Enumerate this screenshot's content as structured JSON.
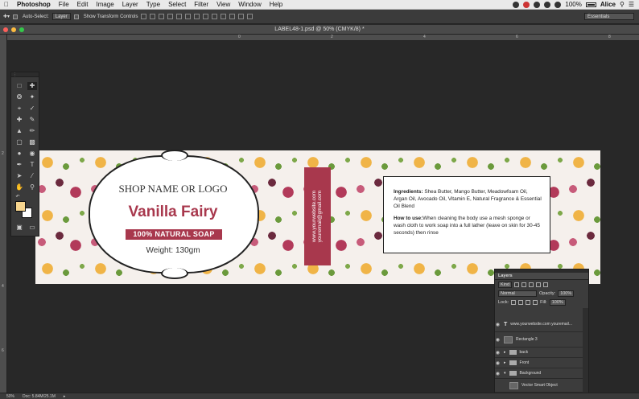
{
  "menubar": {
    "apple": "",
    "app": "Photoshop",
    "items": [
      "File",
      "Edit",
      "Image",
      "Layer",
      "Type",
      "Select",
      "Filter",
      "View",
      "Window",
      "Help"
    ],
    "battery": "100%",
    "user": "Alice"
  },
  "options": {
    "auto_select_label": "Auto-Select:",
    "auto_select_value": "Layer",
    "transform_label": "Show Transform Controls",
    "workspace": "Essentials"
  },
  "document": {
    "title": "LABEL48-1.psd @ 50% (CMYK/8) *",
    "ruler_h": [
      "0",
      "2",
      "4",
      "6",
      "8"
    ],
    "ruler_v": [
      "2",
      "4",
      "6"
    ]
  },
  "label": {
    "shop": "SHOP NAME OR LOGO",
    "product": "Vanilla Fairy",
    "badge": "100% NATURAL SOAP",
    "weight": "Weight: 130gm",
    "strip_line1": "www.yourwebsite.com",
    "strip_line2": "youremail@gmail.com",
    "ingredients_title": "Ingredients:",
    "ingredients": " Shea Butter, Mango Butter, Meadowfoam Oil, Argan Oil, Avocado Oil, Vitamin E, Natural Fragrance & Essential Oil Blend",
    "howto_title": "How to use:",
    "howto": "When cleaning the body use a mesh sponge or wash cloth to work soap into a full lather (leave on skin for 30-45 seconds) then rinse"
  },
  "layers": {
    "tab": "Layers",
    "kind": "Kind",
    "blend": "Normal",
    "opacity_label": "Opacity:",
    "opacity": "100%",
    "lock_label": "Lock:",
    "fill_label": "Fill:",
    "fill": "100%",
    "rows": [
      {
        "name": "www.yourwebsite.com youremail...",
        "type": "text"
      },
      {
        "name": "Rectangle 3",
        "type": "shape"
      },
      {
        "name": "back",
        "type": "folder"
      },
      {
        "name": "Front",
        "type": "folder"
      },
      {
        "name": "Background",
        "type": "folder"
      },
      {
        "name": "Vector Smart Object",
        "type": "smart"
      }
    ]
  },
  "status": {
    "zoom": "50%",
    "doc": "Doc: 5.84M/25.1M"
  },
  "colors": {
    "accent": "#a8384d",
    "foreground": "#f7d58e",
    "background": "#ffffff"
  }
}
